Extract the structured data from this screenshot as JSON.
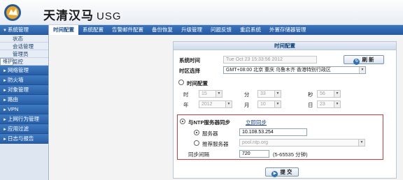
{
  "header": {
    "brand": "天清汉马",
    "product": "USG"
  },
  "tabs": [
    "时间配置",
    "系统配置",
    "告警邮件配置",
    "备份恢复",
    "升级管理",
    "问题反馈",
    "重启系统",
    "外置存储器管理"
  ],
  "sidebar": {
    "groups": [
      {
        "label": "系统管理",
        "sub": [
          "状态",
          "会话管理",
          "管理员",
          "维护",
          "监控"
        ]
      },
      {
        "label": "网络管理"
      },
      {
        "label": "防火墙"
      },
      {
        "label": "对象管理"
      },
      {
        "label": "路由"
      },
      {
        "label": "VPN"
      },
      {
        "label": "上网行为管理"
      },
      {
        "label": "应用过滤"
      },
      {
        "label": "日志与报告"
      }
    ]
  },
  "panel": {
    "title": "时间配置",
    "system_time_label": "系统时间",
    "system_time_value": "Tue Oct 23 15:33:56 2012",
    "refresh_label": "刷 新",
    "timezone_label": "时区选择",
    "timezone_value": "GMT+08:00 北京 重庆 乌鲁木齐 香港特别行政区",
    "time_config_label": "时间配置",
    "hour_label": "时",
    "hour": "15",
    "minute_label": "分",
    "minute": "33",
    "second_label": "秒",
    "second": "56",
    "year_label": "年",
    "year": "2012",
    "month_label": "月",
    "month": "10",
    "day_label": "日",
    "day": "23",
    "ntp_sync_label": "与NTP服务器同步",
    "sync_now_label": "立即同步",
    "server_label": "服务器",
    "server_value": "10.108.53.254",
    "recommended_label": "推荐服务器",
    "recommended_value": "pool.ntp.org",
    "interval_label": "同步间隔",
    "interval_value": "720",
    "interval_hint": "(5-65535 分钟)",
    "submit_label": "提 交"
  }
}
